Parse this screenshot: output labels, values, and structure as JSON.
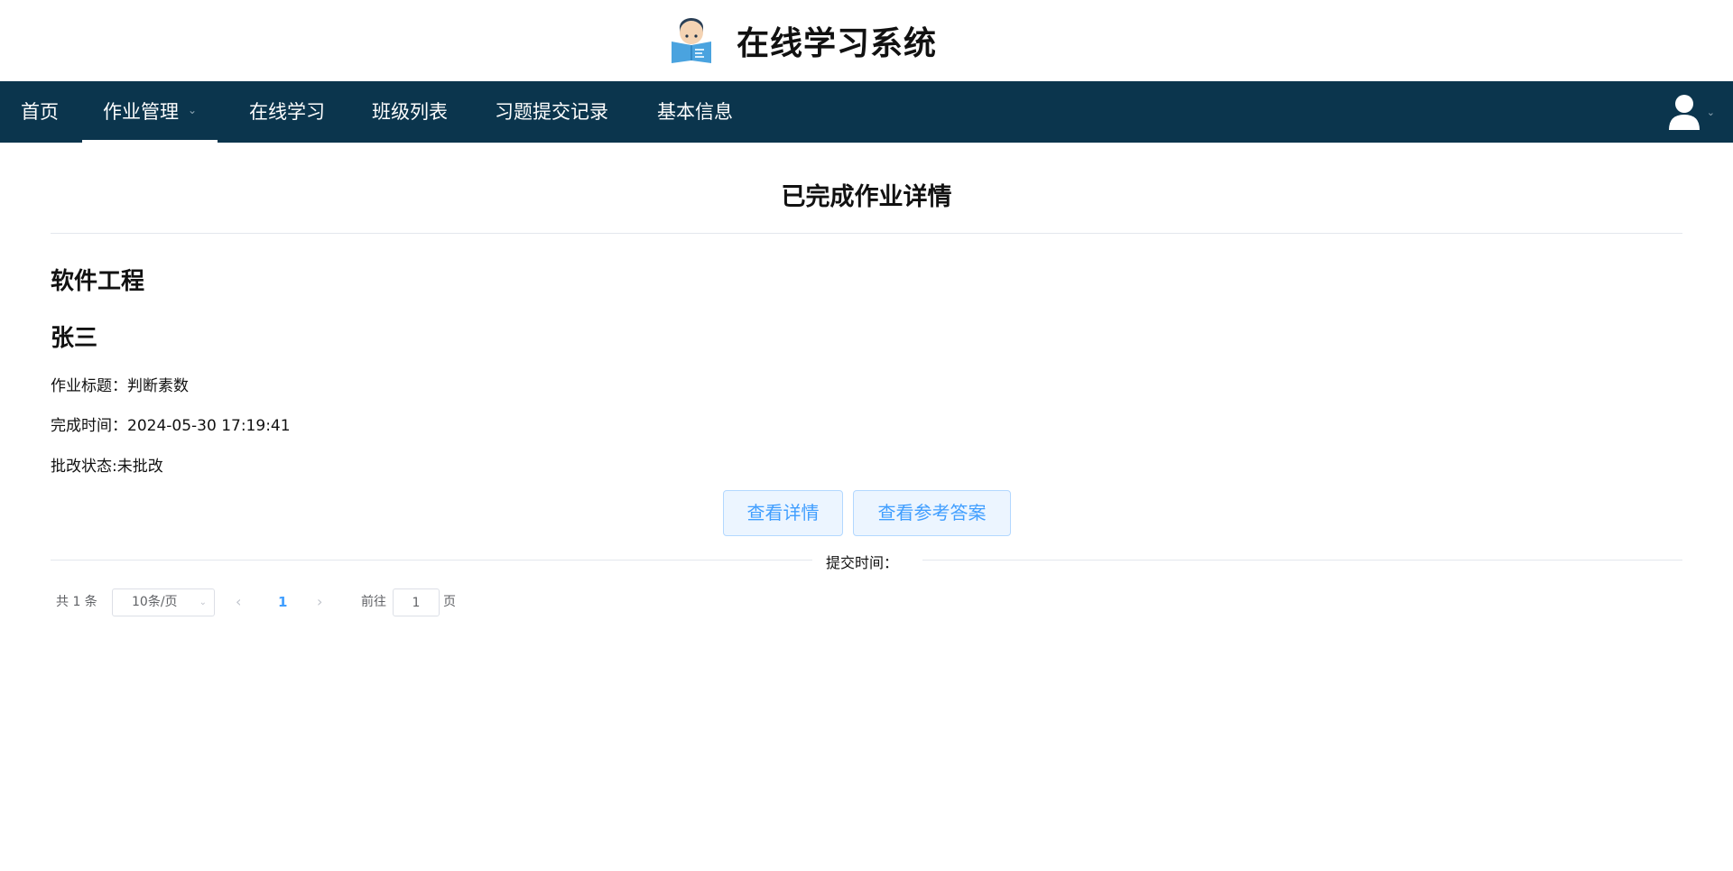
{
  "app": {
    "title": "在线学习系统"
  },
  "nav": {
    "items": [
      {
        "label": "首页"
      },
      {
        "label": "作业管理"
      },
      {
        "label": "在线学习"
      },
      {
        "label": "班级列表"
      },
      {
        "label": "习题提交记录"
      },
      {
        "label": "基本信息"
      }
    ],
    "active": "作业管理"
  },
  "page": {
    "title": "已完成作业详情"
  },
  "detail": {
    "course": "软件工程",
    "student": "张三",
    "title_line": "作业标题：判断素数",
    "time_line": "完成时间：2024-05-30 17:19:41",
    "status_line": "批改状态:未批改"
  },
  "buttons": {
    "view_detail": "查看详情",
    "view_answer": "查看参考答案"
  },
  "divider": {
    "text": "提交时间："
  },
  "pagination": {
    "total": "共 1 条",
    "page_size": "10条/页",
    "current": "1",
    "goto_label": "前往",
    "goto_value": "1",
    "page_suffix": "页"
  },
  "colors": {
    "nav_bg": "#0b354d",
    "accent": "#409eff",
    "button_bg": "#ecf5ff"
  },
  "icons": {
    "logo": "reading-student-icon",
    "user": "user-avatar-icon"
  }
}
